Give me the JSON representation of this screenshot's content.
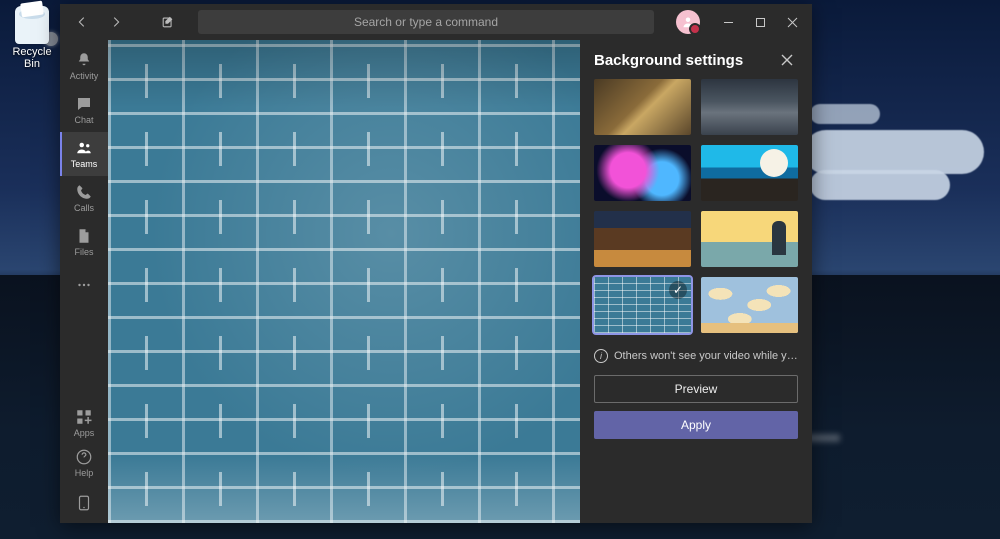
{
  "desktop": {
    "recycle_bin_label": "Recycle Bin"
  },
  "titlebar": {
    "search_placeholder": "Search or type a command",
    "avatar_initial": ""
  },
  "sidebar": {
    "items": [
      {
        "id": "activity",
        "label": "Activity"
      },
      {
        "id": "chat",
        "label": "Chat"
      },
      {
        "id": "teams",
        "label": "Teams",
        "active": true
      },
      {
        "id": "calls",
        "label": "Calls"
      },
      {
        "id": "files",
        "label": "Files"
      },
      {
        "id": "more",
        "label": ""
      }
    ],
    "bottom": [
      {
        "id": "apps",
        "label": "Apps"
      },
      {
        "id": "help",
        "label": "Help"
      },
      {
        "id": "download",
        "label": ""
      }
    ]
  },
  "panel": {
    "title": "Background settings",
    "info_text": "Others won't see your video while you previe...",
    "preview_label": "Preview",
    "apply_label": "Apply",
    "thumbnails": [
      {
        "id": "castle",
        "class": "tcastle"
      },
      {
        "id": "robots",
        "class": "trobots"
      },
      {
        "id": "nebula",
        "class": "tnebula"
      },
      {
        "id": "mountain-moon",
        "class": "tmntmoon"
      },
      {
        "id": "alley",
        "class": "talley"
      },
      {
        "id": "sunset-person",
        "class": "tsunset"
      },
      {
        "id": "blue-brick",
        "class": "tbrick",
        "selected": true
      },
      {
        "id": "toy-clouds",
        "class": "tclouds"
      }
    ]
  }
}
